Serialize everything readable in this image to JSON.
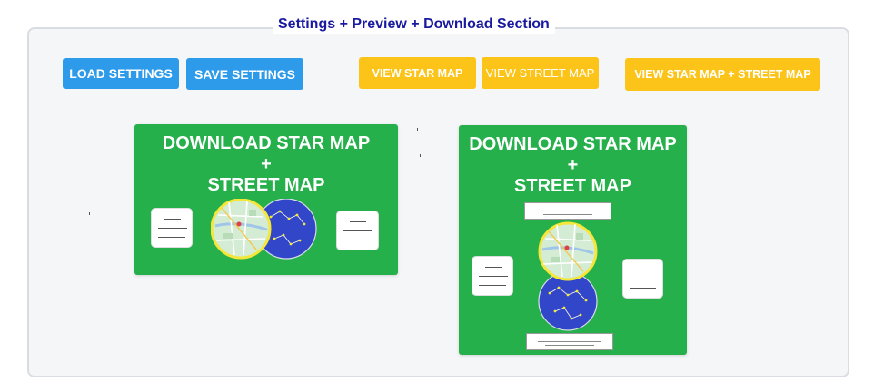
{
  "section": {
    "title": "Settings + Preview + Download Section"
  },
  "toolbar": {
    "load_settings_label": "LOAD SETTINGS",
    "save_settings_label": "SAVE SETTINGS",
    "view_star_map_label": "VIEW STAR MAP",
    "view_street_map_label": "VIEW STREET MAP",
    "view_both_label": "VIEW STAR MAP + STREET MAP"
  },
  "download_cards": [
    {
      "line1": "DOWNLOAD STAR MAP",
      "line2": "+",
      "line3": "STREET MAP",
      "layout": "horizontal"
    },
    {
      "line1": "DOWNLOAD STAR MAP",
      "line2": "+",
      "line3": "STREET MAP",
      "layout": "vertical"
    }
  ],
  "colors": {
    "blue_button": "#2d9be9",
    "yellow_button": "#fcc419",
    "card_green": "#26b04c",
    "star_map_blue": "#3146c8",
    "street_map_green": "#d4ecd4",
    "ring_yellow": "#f5e63a",
    "section_title": "#1a1aa0"
  },
  "icons": [
    "street-map-circle-icon",
    "star-map-circle-icon"
  ]
}
